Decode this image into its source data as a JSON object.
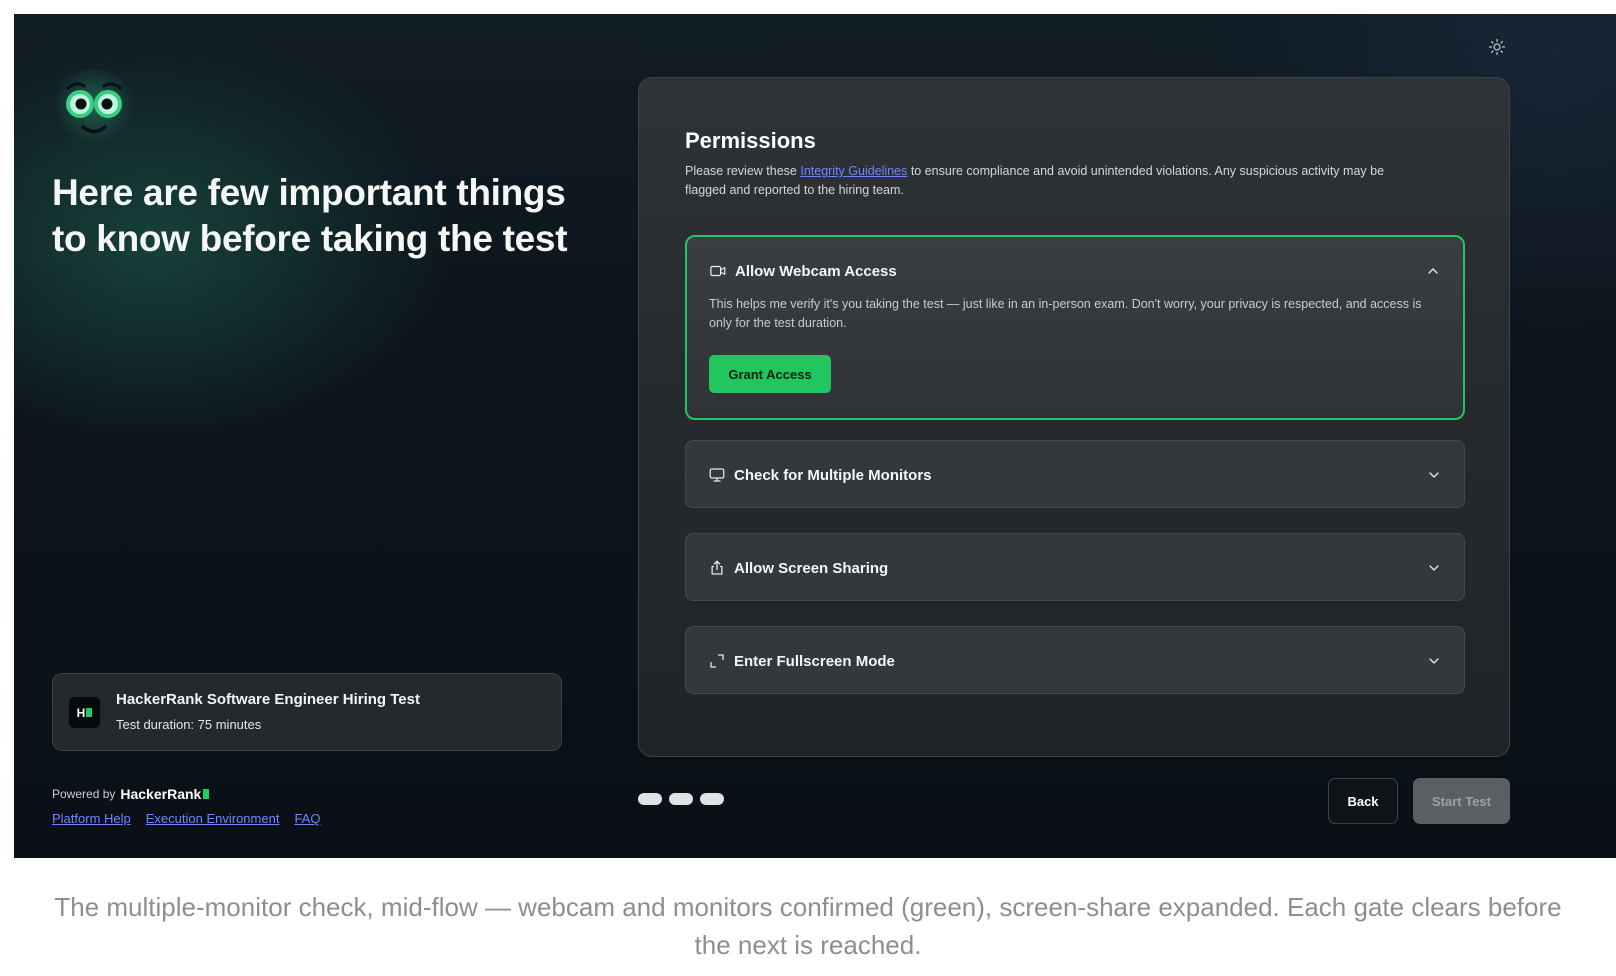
{
  "header": {
    "theme_icon": "sun-icon"
  },
  "left": {
    "mascot_icon": "owl-eyes-logo",
    "headline": "Here are few important things to know before taking the test",
    "test_card": {
      "logo_text": "H",
      "title": "HackerRank Software Engineer Hiring Test",
      "duration": "Test duration: 75 minutes"
    },
    "powered_by": {
      "prefix": "Powered by",
      "brand": "HackerRank"
    },
    "footer_links": [
      "Platform Help",
      "Execution Environment",
      "FAQ"
    ]
  },
  "permissions": {
    "title": "Permissions",
    "desc_prefix": "Please review these ",
    "desc_link": "Integrity Guidelines",
    "desc_suffix": " to ensure compliance and avoid unintended violations. Any suspicious activity may be flagged and reported to the hiring team.",
    "items": [
      {
        "label": "Allow Webcam Access",
        "icon": "video-camera-icon",
        "expanded": true,
        "body": "This helps me verify it's you taking the test — just like in an in-person exam. Don't worry, your privacy is respected, and access is only for the test duration.",
        "button": "Grant Access"
      },
      {
        "label": "Check for Multiple Monitors",
        "icon": "monitor-icon",
        "expanded": false
      },
      {
        "label": "Allow Screen Sharing",
        "icon": "share-upload-icon",
        "expanded": false
      },
      {
        "label": "Enter Fullscreen Mode",
        "icon": "expand-icon",
        "expanded": false
      }
    ]
  },
  "nav": {
    "step_count": 3,
    "back_label": "Back",
    "start_label": "Start Test"
  },
  "caption": "The multiple-monitor check, mid-flow — webcam and monitors confirmed (green), screen-share expanded. Each gate clears before the next is reached.",
  "colors": {
    "accent_green": "#22c55e",
    "link_blue": "#6f86ff",
    "background": "#0c141b"
  }
}
